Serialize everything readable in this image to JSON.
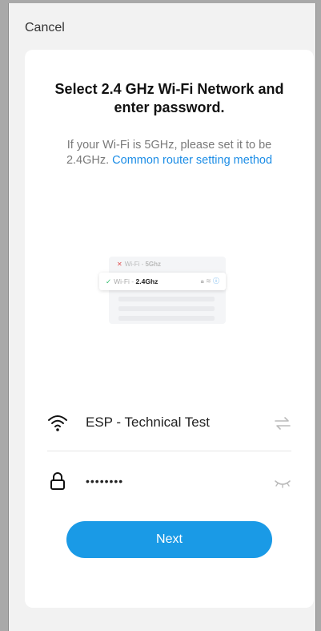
{
  "header": {
    "cancel_label": "Cancel"
  },
  "card": {
    "title": "Select 2.4 GHz Wi-Fi Network and enter password.",
    "subtitle_text": "If your Wi-Fi is 5GHz, please set it to be 2.4GHz.",
    "subtitle_link": "Common router setting method"
  },
  "illustration": {
    "row1_prefix": "Wi-Fi - ",
    "row1_band": "5Ghz",
    "row2_prefix": "Wi-Fi - ",
    "row2_band": "2.4Ghz"
  },
  "wifi": {
    "ssid": "ESP - Technical Test"
  },
  "password": {
    "masked_value": "••••••••"
  },
  "next_label": "Next",
  "colors": {
    "accent": "#1a9ae6",
    "link": "#1c8de6"
  },
  "icons": {
    "wifi": "wifi-icon",
    "switch": "switch-arrows-icon",
    "lock": "lock-icon",
    "eye": "eye-closed-icon"
  }
}
